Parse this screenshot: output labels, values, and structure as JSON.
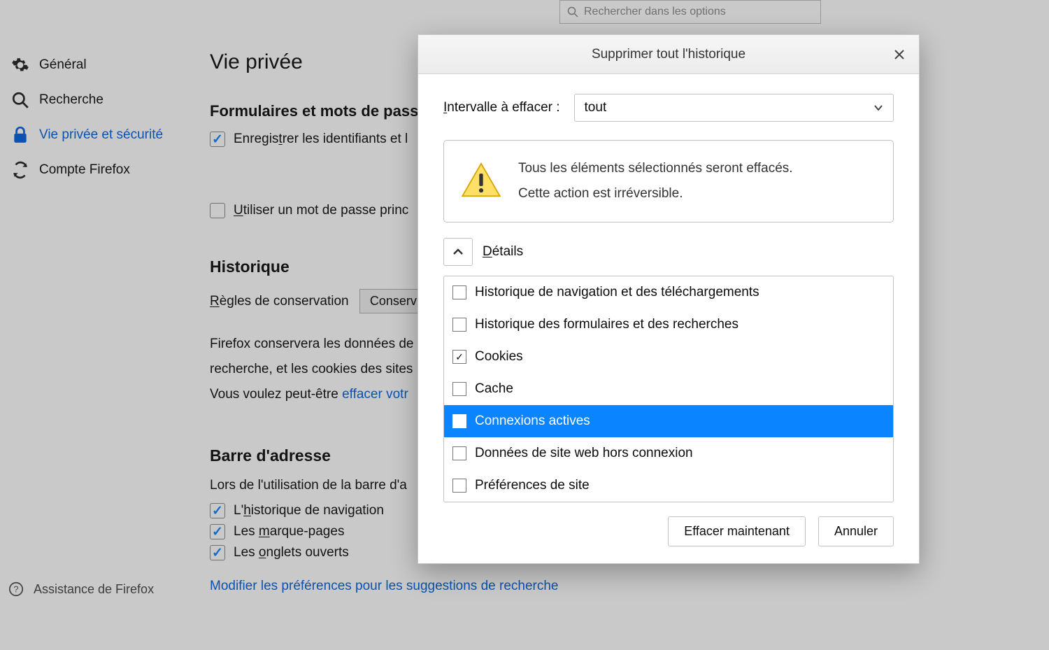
{
  "search": {
    "placeholder": "Rechercher dans les options"
  },
  "sidebar": {
    "items": [
      {
        "label": "Général"
      },
      {
        "label": "Recherche"
      },
      {
        "label": "Vie privée et sécurité"
      },
      {
        "label": "Compte Firefox"
      }
    ],
    "footer": "Assistance de Firefox"
  },
  "content": {
    "page_title": "Vie privée",
    "forms_heading": "Formulaires et mots de passe",
    "save_logins_label": "Enregistrer les identifiants et l",
    "master_password_label": "tiliser un mot de passe princ",
    "master_password_prefix": "U",
    "history_heading": "Historique",
    "retention_label": "ègles de conservation",
    "retention_prefix": "R",
    "retention_button": "Conserv",
    "history_desc_line1": "Firefox conservera les données de",
    "history_desc_line2": "recherche, et les cookies des sites",
    "history_desc_line3_prefix": "Vous voulez peut-être ",
    "history_desc_line3_link": "effacer votr",
    "address_bar_heading": "Barre d'adresse",
    "address_bar_desc": "Lors de l'utilisation de la barre d'a",
    "ab_history_prefix": "L'",
    "ab_history": "istorique de navigation",
    "ab_history_u": "h",
    "ab_bookmarks_prefix": "Les ",
    "ab_bookmarks": "arque-pages",
    "ab_bookmarks_u": "m",
    "ab_tabs_prefix": "Les ",
    "ab_tabs": "nglets ouverts",
    "ab_tabs_u": "o",
    "search_suggestions_link": "Modifier les préférences pour les suggestions de recherche"
  },
  "dialog": {
    "title": "Supprimer tout l'historique",
    "interval_label_prefix": "I",
    "interval_label": "ntervalle à effacer :",
    "interval_value": "tout",
    "warning_line1": "Tous les éléments sélectionnés seront effacés.",
    "warning_line2": "Cette action est irréversible.",
    "details_label": "étails",
    "details_prefix": "D",
    "options": [
      {
        "label": "Historique de navigation et des téléchargements",
        "checked": false,
        "selected": false
      },
      {
        "label": "Historique des formulaires et des recherches",
        "checked": false,
        "selected": false
      },
      {
        "label": "Cookies",
        "checked": true,
        "selected": false
      },
      {
        "label": "Cache",
        "checked": false,
        "selected": false
      },
      {
        "label": "Connexions actives",
        "checked": false,
        "selected": true
      },
      {
        "label": "Données de site web hors connexion",
        "checked": false,
        "selected": false
      },
      {
        "label": "Préférences de site",
        "checked": false,
        "selected": false
      }
    ],
    "confirm_button": "Effacer maintenant",
    "cancel_button": "Annuler"
  }
}
